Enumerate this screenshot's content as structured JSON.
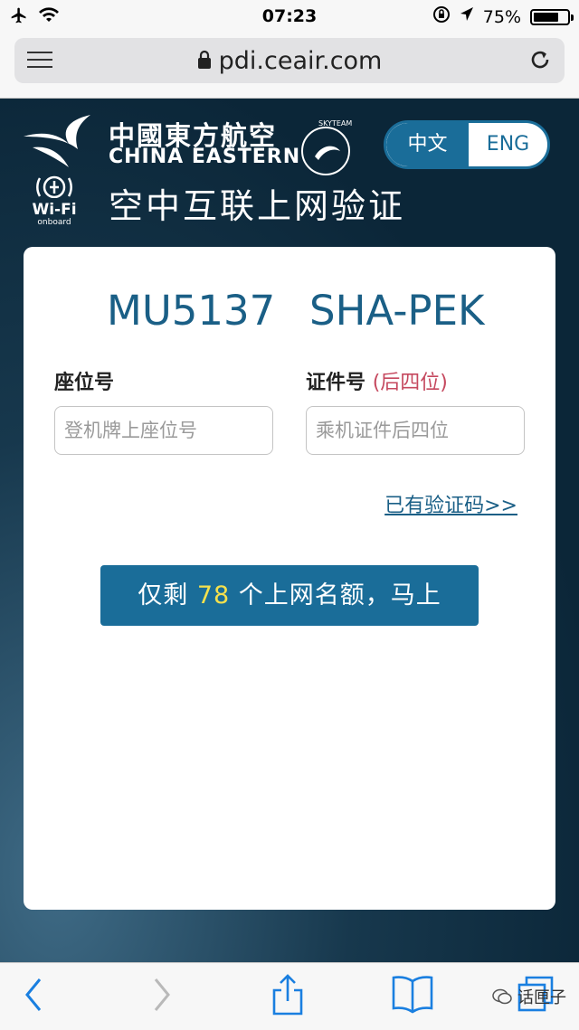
{
  "status_bar": {
    "time": "07:23",
    "battery": "75%",
    "battery_level": 0.75
  },
  "browser": {
    "url": "pdi.ceair.com"
  },
  "header": {
    "brand_cn": "中國東方航空",
    "brand_en": "CHINA EASTERN",
    "skyteam": "SKYTEAM",
    "wifi_label": "Wi-Fi",
    "wifi_sub": "onboard",
    "lang_cn": "中文",
    "lang_en": "ENG",
    "title": "空中互联上网验证"
  },
  "card": {
    "flight_no": "MU5137",
    "route": "SHA-PEK",
    "seat_label": "座位号",
    "id_label": "证件号",
    "id_hint": "(后四位)",
    "seat_placeholder": "登机牌上座位号",
    "id_placeholder": "乘机证件后四位",
    "have_code": "已有验证码>>",
    "cta_prefix": "仅剩",
    "cta_count": "78",
    "cta_suffix": "个上网名额，马上"
  },
  "watermark": "话匣子",
  "colors": {
    "accent": "#1a6d99",
    "highlight": "#f4e04d",
    "hint": "#c5485e",
    "header_bg": "#0b2638"
  }
}
